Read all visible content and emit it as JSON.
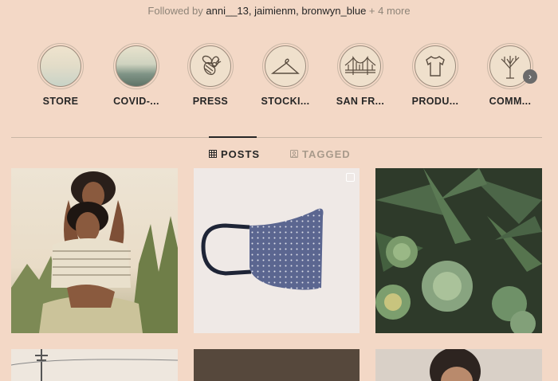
{
  "followed": {
    "prefix": "Followed by ",
    "names": "anni__13, jaimienm, bronwyn_blue",
    "suffix": " + 4 more"
  },
  "highlights": [
    {
      "label": "STORE",
      "icon": "pastel-gradient"
    },
    {
      "label": "COVID-...",
      "icon": "landscape-photo"
    },
    {
      "label": "PRESS",
      "icon": "bee-icon"
    },
    {
      "label": "STOCKI...",
      "icon": "hanger-icon"
    },
    {
      "label": "SAN FR...",
      "icon": "bridge-icon"
    },
    {
      "label": "PRODU...",
      "icon": "tshirt-icon"
    },
    {
      "label": "COMM...",
      "icon": "tree-icon"
    }
  ],
  "tabs": {
    "posts": "POSTS",
    "tagged": "TAGGED"
  },
  "posts": [
    {
      "subject": "two women posing in tall grass"
    },
    {
      "subject": "blue polka dot face mask"
    },
    {
      "subject": "succulent plants"
    },
    {
      "subject": "utility pole"
    },
    {
      "subject": "dark photo"
    },
    {
      "subject": "portrait"
    }
  ]
}
